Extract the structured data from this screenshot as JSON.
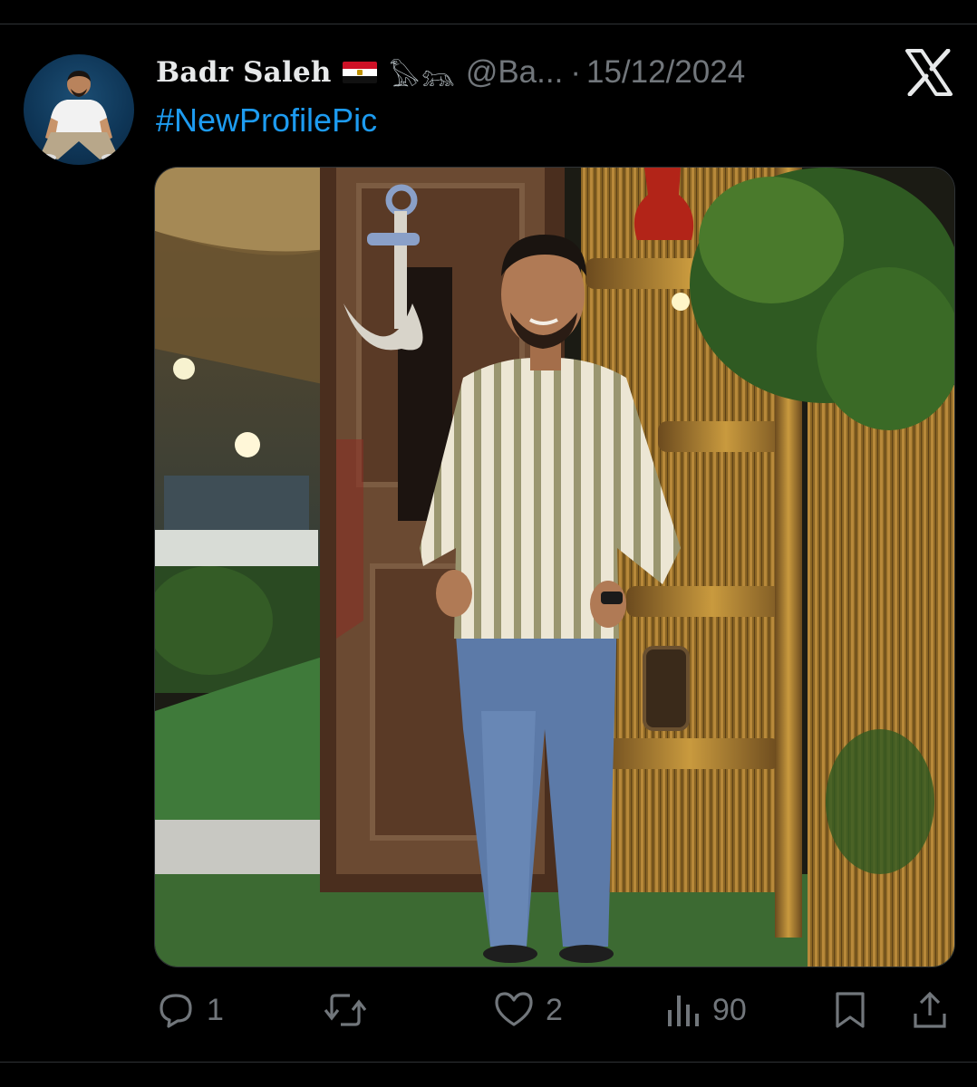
{
  "post": {
    "author_name": "Badr Saleh",
    "flag_emoji_icon": "egypt-flag-icon",
    "name_suffix": "𓅃𓃬",
    "handle": "@Ba...",
    "separator": "·",
    "date": "15/12/2024",
    "hashtag": "#NewProfilePic"
  },
  "actions": {
    "replies": "1",
    "reposts": "",
    "likes": "2",
    "views": "90"
  },
  "colors": {
    "background": "#000000",
    "link": "#1d9bf0",
    "muted": "#71767b",
    "text": "#e7e9ea"
  },
  "icons": [
    "x-logo-icon",
    "reply-icon",
    "repost-icon",
    "like-icon",
    "views-icon",
    "bookmark-icon",
    "share-icon"
  ]
}
